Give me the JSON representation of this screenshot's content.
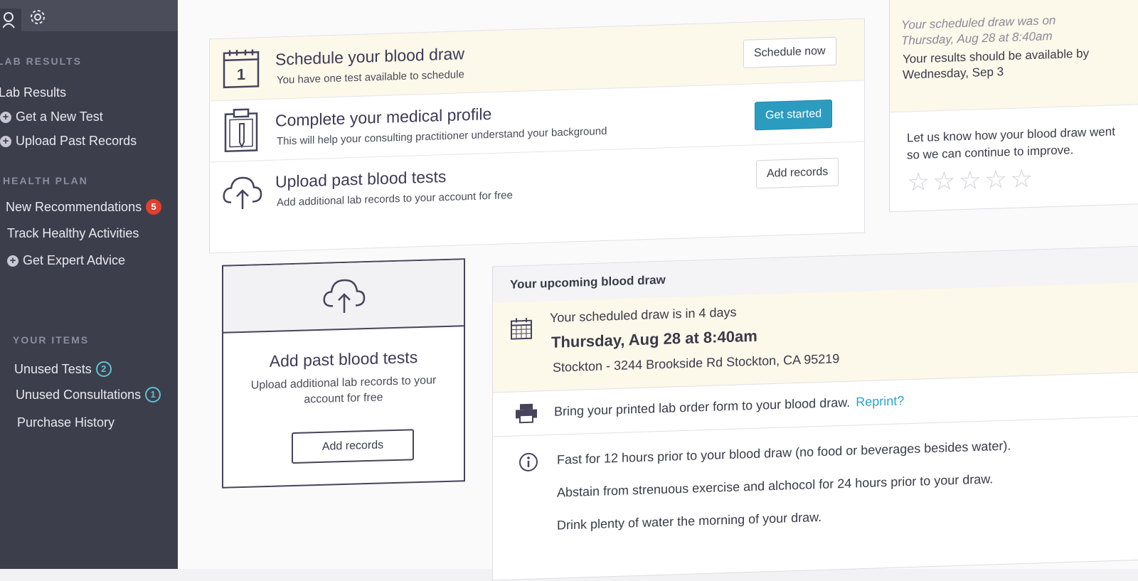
{
  "sidebar": {
    "sections": {
      "lab_results": "LAB RESULTS",
      "health_plan": "HEALTH PLAN",
      "your_items": "YOUR ITEMS"
    },
    "lab_items": [
      "Lab Results",
      "Get a New Test",
      "Upload Past Records"
    ],
    "health_items": [
      "New Recommendations",
      "Track Healthy Activities",
      "Get Expert Advice"
    ],
    "recommendations_count": "5",
    "your_items": [
      "Unused Tests",
      "Unused Consultations",
      "Purchase History"
    ],
    "unused_tests_count": "2",
    "unused_consultations_count": "1",
    "icons": [
      "user-icon",
      "gear-icon"
    ]
  },
  "tasks": [
    {
      "title": "Schedule your blood draw",
      "subtitle": "You have one test available to schedule",
      "button": "Schedule now",
      "icon": "calendar-icon",
      "calendar_day": "1"
    },
    {
      "title": "Complete your medical profile",
      "subtitle": "This will help your consulting practitioner understand your background",
      "button": "Get started",
      "icon": "clipboard-icon"
    },
    {
      "title": "Upload past blood tests",
      "subtitle": "Add additional lab records to your account for free",
      "button": "Add records",
      "icon": "cloud-upload-icon"
    }
  ],
  "upload_card": {
    "title": "Add past blood tests",
    "subtitle": "Upload additional lab records to your account for free",
    "button": "Add records"
  },
  "upcoming": {
    "header": "Your upcoming blood draw",
    "in_days": "Your scheduled draw is in 4 days",
    "date": "Thursday, Aug 28 at 8:40am",
    "address": "Stockton - 3244 Brookside Rd Stockton, CA 95219",
    "print_text": "Bring your printed lab order form to your blood draw.",
    "reprint": "Reprint?",
    "instructions": [
      "Fast for 12 hours prior to your blood draw (no food or beverages besides water).",
      "Abstain from strenuous exercise and alchocol for 24 hours prior to your draw.",
      "Drink plenty of water the morning of your draw."
    ]
  },
  "past_draw": {
    "was_on_line1": "Your scheduled draw was on",
    "was_on_line2": "Thursday, Aug 28 at 8:40am",
    "available_line1": "Your results should be available by",
    "available_line2": "Wednesday, Sep 3",
    "feedback_line1": "Let us know how your blood draw went",
    "feedback_line2": "so we can continue to improve.",
    "rating": 0,
    "rating_max": 5
  },
  "colors": {
    "sidebar": "#3c3e4c",
    "highlight": "#fcf8ea",
    "primary": "#2b9cc0",
    "badge": "#e0412e",
    "link": "#2aa5c8"
  }
}
